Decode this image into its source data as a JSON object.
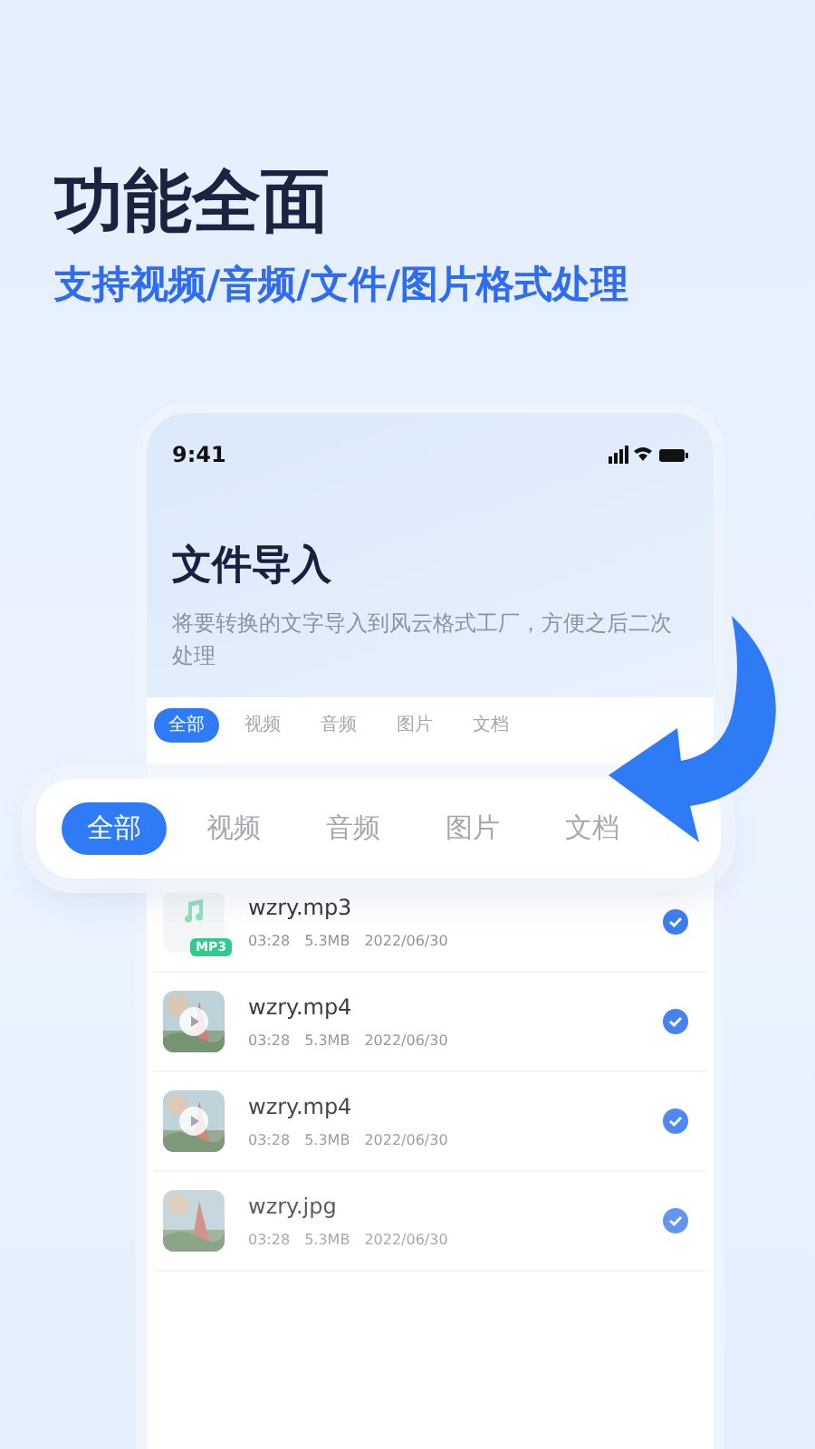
{
  "headline": "功能全面",
  "subheadline": "支持视频/音频/文件/图片格式处理",
  "phone": {
    "status_time": "9:41",
    "title": "文件导入",
    "description": "将要转换的文字导入到风云格式工厂，方便之后二次处理",
    "tabs": [
      {
        "label": "全部",
        "selected": true
      },
      {
        "label": "视频",
        "selected": false
      },
      {
        "label": "音频",
        "selected": false
      },
      {
        "label": "图片",
        "selected": false
      },
      {
        "label": "文档",
        "selected": false
      }
    ],
    "files": [
      {
        "kind": "audio",
        "badge": "MP3",
        "name": "wzry.mp3",
        "duration": "03:28",
        "size": "5.3MB",
        "date": "2022/06/30",
        "checked": true
      },
      {
        "kind": "video",
        "name": "wzry.mp4",
        "duration": "03:28",
        "size": "5.3MB",
        "date": "2022/06/30",
        "checked": true
      },
      {
        "kind": "video",
        "name": "wzry.mp4",
        "duration": "03:28",
        "size": "5.3MB",
        "date": "2022/06/30",
        "checked": true
      },
      {
        "name": "wzry.jpg",
        "duration": "03:28",
        "size": "5.3MB",
        "date": "2022/06/30",
        "checked": true
      }
    ]
  },
  "zoomed_tabs": [
    {
      "label": "全部",
      "selected": true
    },
    {
      "label": "视频",
      "selected": false
    },
    {
      "label": "音频",
      "selected": false
    },
    {
      "label": "图片",
      "selected": false
    },
    {
      "label": "文档",
      "selected": false
    }
  ]
}
